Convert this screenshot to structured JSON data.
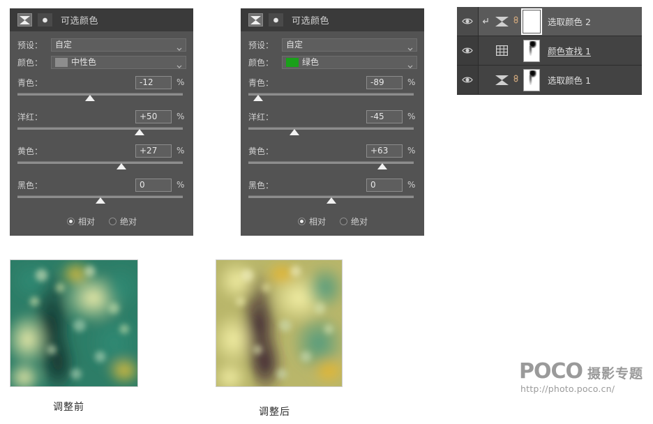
{
  "panels": [
    {
      "id": "panel-neutral",
      "title": "可选颜色",
      "preset_label": "预设：",
      "preset_value": "自定",
      "color_label": "颜色：",
      "color_value": "中性色",
      "color_swatch": "#8d8d8d",
      "sliders": [
        {
          "name": "青色：",
          "value": "-12",
          "unit": "%",
          "pos": 44
        },
        {
          "name": "洋红：",
          "value": "+50",
          "unit": "%",
          "pos": 74
        },
        {
          "name": "黄色：",
          "value": "+27",
          "unit": "%",
          "pos": 63
        },
        {
          "name": "黑色：",
          "value": "0",
          "unit": "%",
          "pos": 50
        }
      ],
      "method": {
        "relative_label": "相对",
        "absolute_label": "绝对",
        "selected": "relative"
      }
    },
    {
      "id": "panel-green",
      "title": "可选颜色",
      "preset_label": "预设：",
      "preset_value": "自定",
      "color_label": "颜色：",
      "color_value": "绿色",
      "color_swatch": "#1aa01a",
      "sliders": [
        {
          "name": "青色：",
          "value": "-89",
          "unit": "%",
          "pos": 6
        },
        {
          "name": "洋红：",
          "value": "-45",
          "unit": "%",
          "pos": 28
        },
        {
          "name": "黄色：",
          "value": "+63",
          "unit": "%",
          "pos": 81
        },
        {
          "name": "黑色：",
          "value": "0",
          "unit": "%",
          "pos": 50
        }
      ],
      "method": {
        "relative_label": "相对",
        "absolute_label": "绝对",
        "selected": "relative"
      }
    }
  ],
  "layers": [
    {
      "name": "选取颜色 2",
      "icon": "selective-color-icon",
      "selected": true,
      "clipped": true,
      "linked": true,
      "mask": "white",
      "editing": false
    },
    {
      "name": "颜色查找 1",
      "icon": "color-lookup-icon",
      "selected": false,
      "clipped": false,
      "linked": false,
      "mask": "painted",
      "editing": true
    },
    {
      "name": "选取颜色 1",
      "icon": "selective-color-icon",
      "selected": false,
      "clipped": false,
      "linked": true,
      "mask": "painted",
      "editing": false
    }
  ],
  "samples": {
    "before_caption": "调整前",
    "after_caption": "调整后"
  },
  "watermark": {
    "brand": "POCO",
    "subtitle": "摄影专题",
    "url": "http://photo.poco.cn/"
  }
}
